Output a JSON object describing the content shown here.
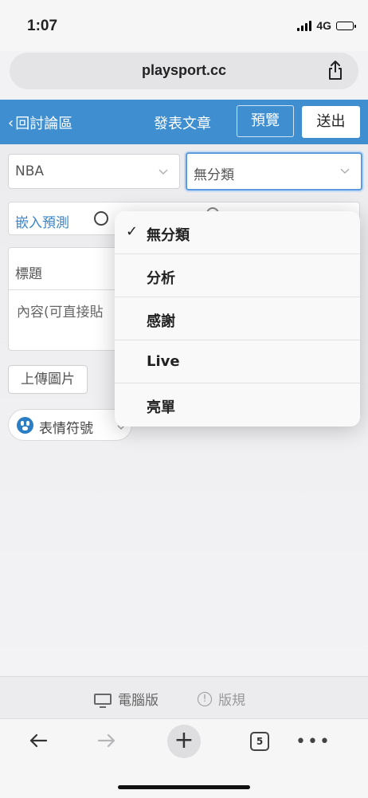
{
  "status_bar": {
    "time": "1:07",
    "network": "4G"
  },
  "browser": {
    "url": "playsport.cc"
  },
  "header": {
    "back_label": "回討論區",
    "title": "發表文章",
    "preview_label": "預覽",
    "send_label": "送出"
  },
  "form": {
    "league_value": "NBA",
    "category_value": "無分類",
    "embed_label": "嵌入預測",
    "title_placeholder": "標題",
    "content_placeholder": "內容(可直接貼",
    "upload_label": "上傳圖片",
    "emoji_label": "表情符號"
  },
  "dropdown": {
    "selected": "無分類",
    "options": [
      "無分類",
      "分析",
      "感謝",
      "Live",
      "亮單"
    ]
  },
  "footer": {
    "desktop_label": "電腦版",
    "rules_label": "版規"
  },
  "toolbar": {
    "tab_count": "5"
  }
}
